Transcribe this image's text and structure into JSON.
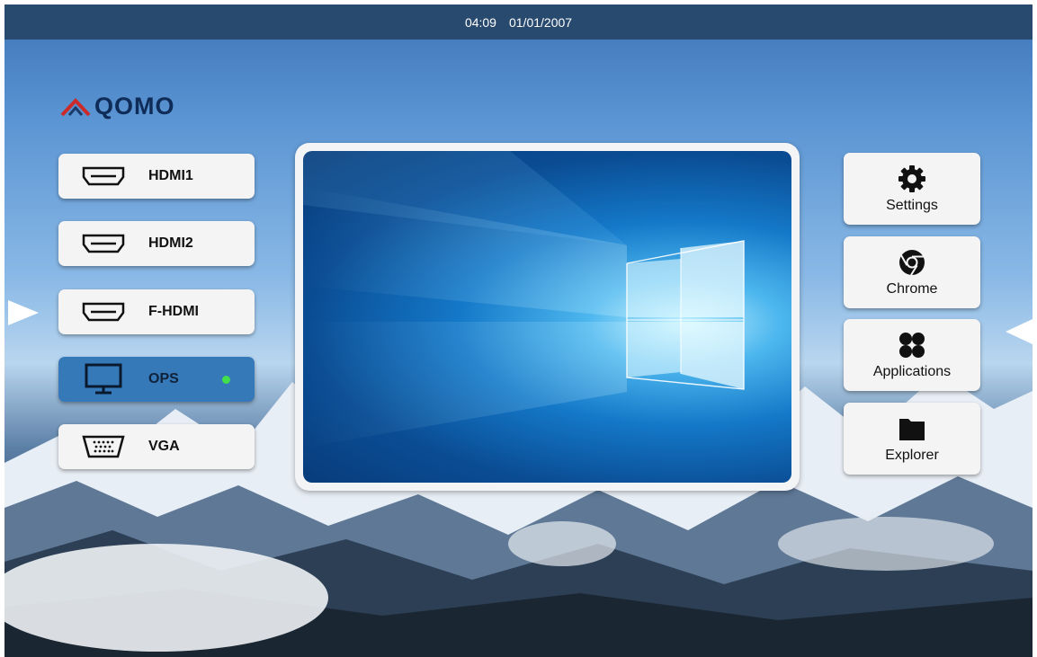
{
  "status_bar": {
    "time": "04:09",
    "date": "01/01/2007"
  },
  "brand": {
    "name": "QOMO",
    "color": "#0e2c57",
    "accent": "#cc2a2a"
  },
  "sources": [
    {
      "label": "HDMI1",
      "icon": "hdmi-port-icon",
      "active": false
    },
    {
      "label": "HDMI2",
      "icon": "hdmi-port-icon",
      "active": false
    },
    {
      "label": "F-HDMI",
      "icon": "hdmi-port-icon",
      "active": false
    },
    {
      "label": "OPS",
      "icon": "monitor-icon",
      "active": true,
      "signal": true
    },
    {
      "label": "VGA",
      "icon": "vga-port-icon",
      "active": false
    }
  ],
  "apps": [
    {
      "label": "Settings",
      "icon": "gear-icon"
    },
    {
      "label": "Chrome",
      "icon": "chrome-icon"
    },
    {
      "label": "Applications",
      "icon": "apps-grid-icon"
    },
    {
      "label": "Explorer",
      "icon": "folder-icon"
    }
  ],
  "colors": {
    "active_source": "#3579b8",
    "signal_dot": "#41e04a",
    "top_bar": "#294a6f"
  }
}
